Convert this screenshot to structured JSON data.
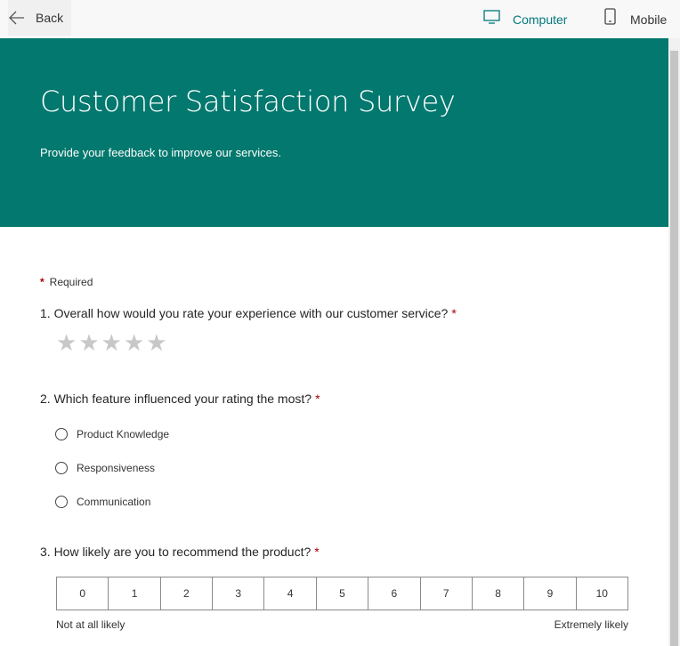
{
  "topbar": {
    "back_label": "Back",
    "views": [
      {
        "label": "Computer",
        "icon": "monitor-icon",
        "active": true
      },
      {
        "label": "Mobile",
        "icon": "phone-icon",
        "active": false
      }
    ]
  },
  "header": {
    "title": "Customer Satisfaction Survey",
    "subtitle": "Provide your feedback to improve our services.",
    "accent_color": "#03786e"
  },
  "form": {
    "required_marker": "*",
    "required_note": "Required",
    "questions": [
      {
        "text": "1. Overall how would you rate your experience with our customer service?",
        "required": "*",
        "type": "rating",
        "stars": [
          "★",
          "★",
          "★",
          "★",
          "★"
        ]
      },
      {
        "text": "2. Which feature influenced your rating the most?",
        "required": "*",
        "type": "choice",
        "options": [
          "Product Knowledge",
          "Responsiveness",
          "Communication"
        ]
      },
      {
        "text": "3. How likely are you to recommend the product?",
        "required": "*",
        "type": "scale",
        "scale": [
          "0",
          "1",
          "2",
          "3",
          "4",
          "5",
          "6",
          "7",
          "8",
          "9",
          "10"
        ],
        "low_label": "Not at all likely",
        "high_label": "Extremely likely"
      }
    ]
  }
}
